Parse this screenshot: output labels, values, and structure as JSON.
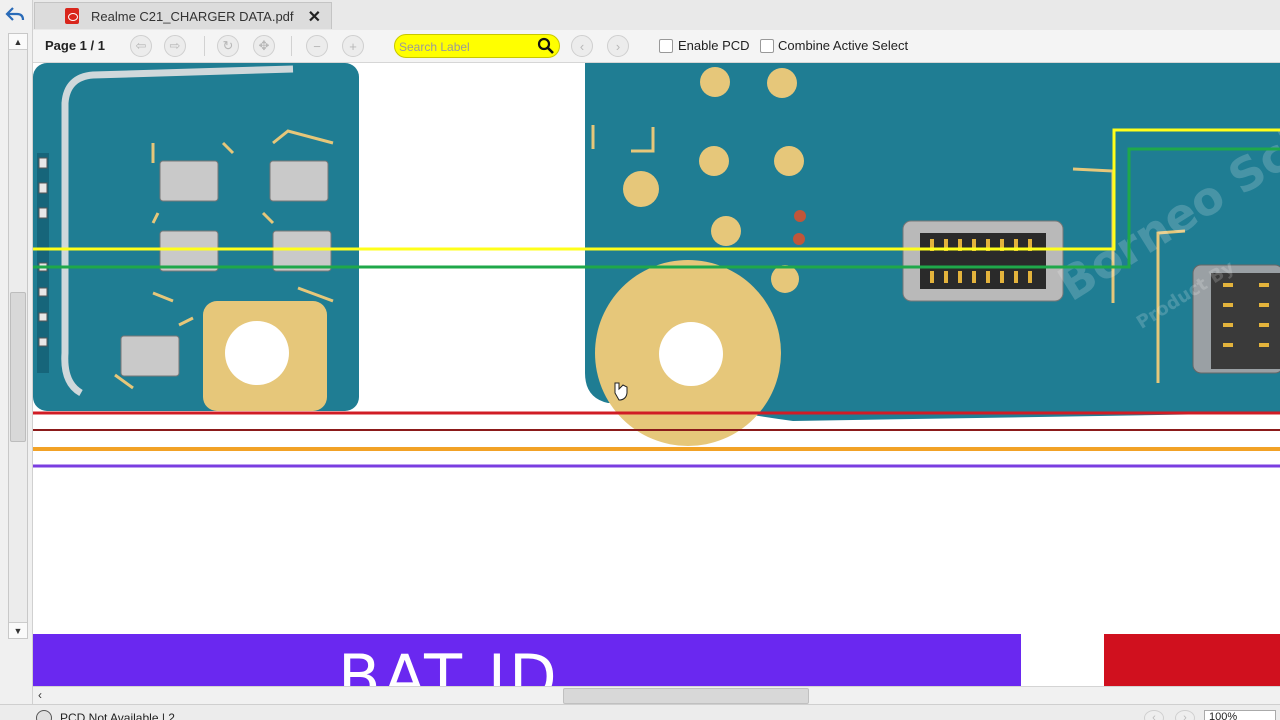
{
  "tab": {
    "title": "Realme C21_CHARGER DATA.pdf",
    "close": "✕"
  },
  "toolbar": {
    "page_label": "Page 1 / 1",
    "search_placeholder": "Search Label",
    "enable_pcd": "Enable PCD",
    "combine_active_select": "Combine Active Select"
  },
  "board": {
    "rail_colors": {
      "yellow": "#ffff1a",
      "green": "#1fa84a",
      "red": "#d01c25",
      "dark_red": "#8b1a1a",
      "orange": "#f2a226",
      "purple": "#7a3ee0"
    },
    "pcb_color": "#1f7d93",
    "gold_color": "#e6c77a",
    "watermark": "Borneo Schematics",
    "watermark_sub": "Product By"
  },
  "net_labels": {
    "bat_id": "BAT  ID",
    "bat_id_color": "#6a28f0",
    "right_color": "#d0101e"
  },
  "statusbar": {
    "text": "PCD Not Available | 2",
    "zoom": "100%"
  }
}
